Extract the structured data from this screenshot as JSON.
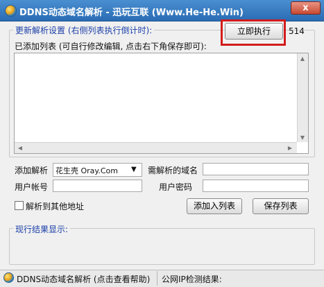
{
  "window": {
    "title": "DDNS动态域名解析 - 迅玩互联 (Www.He-He.Win)",
    "close_glyph": "x"
  },
  "settings_group": {
    "legend": "更新解析设置 (右侧列表执行倒计时):",
    "execute_button": "立即执行",
    "countdown": "514",
    "list_label": "已添加列表 (可自行修改编辑, 点击右下角保存即可):"
  },
  "form": {
    "add_resolve_label": "添加解析",
    "provider_selected": "花生壳 Oray.Com",
    "domain_label": "需解析的域名",
    "account_label": "用户帐号",
    "password_label": "用户密码",
    "other_address_label": "解析到其他地址",
    "add_button": "添加入列表",
    "save_button": "保存列表"
  },
  "results_group": {
    "legend": "现行结果显示:"
  },
  "statusbar": {
    "help_text": "DDNS动态域名解析 (点击查看帮助)",
    "ip_label": "公网IP检测结果:"
  },
  "colors": {
    "title_bar": "#2a6cb4",
    "group_legend": "#1a3fa8",
    "highlight_box": "#d21c1c"
  }
}
